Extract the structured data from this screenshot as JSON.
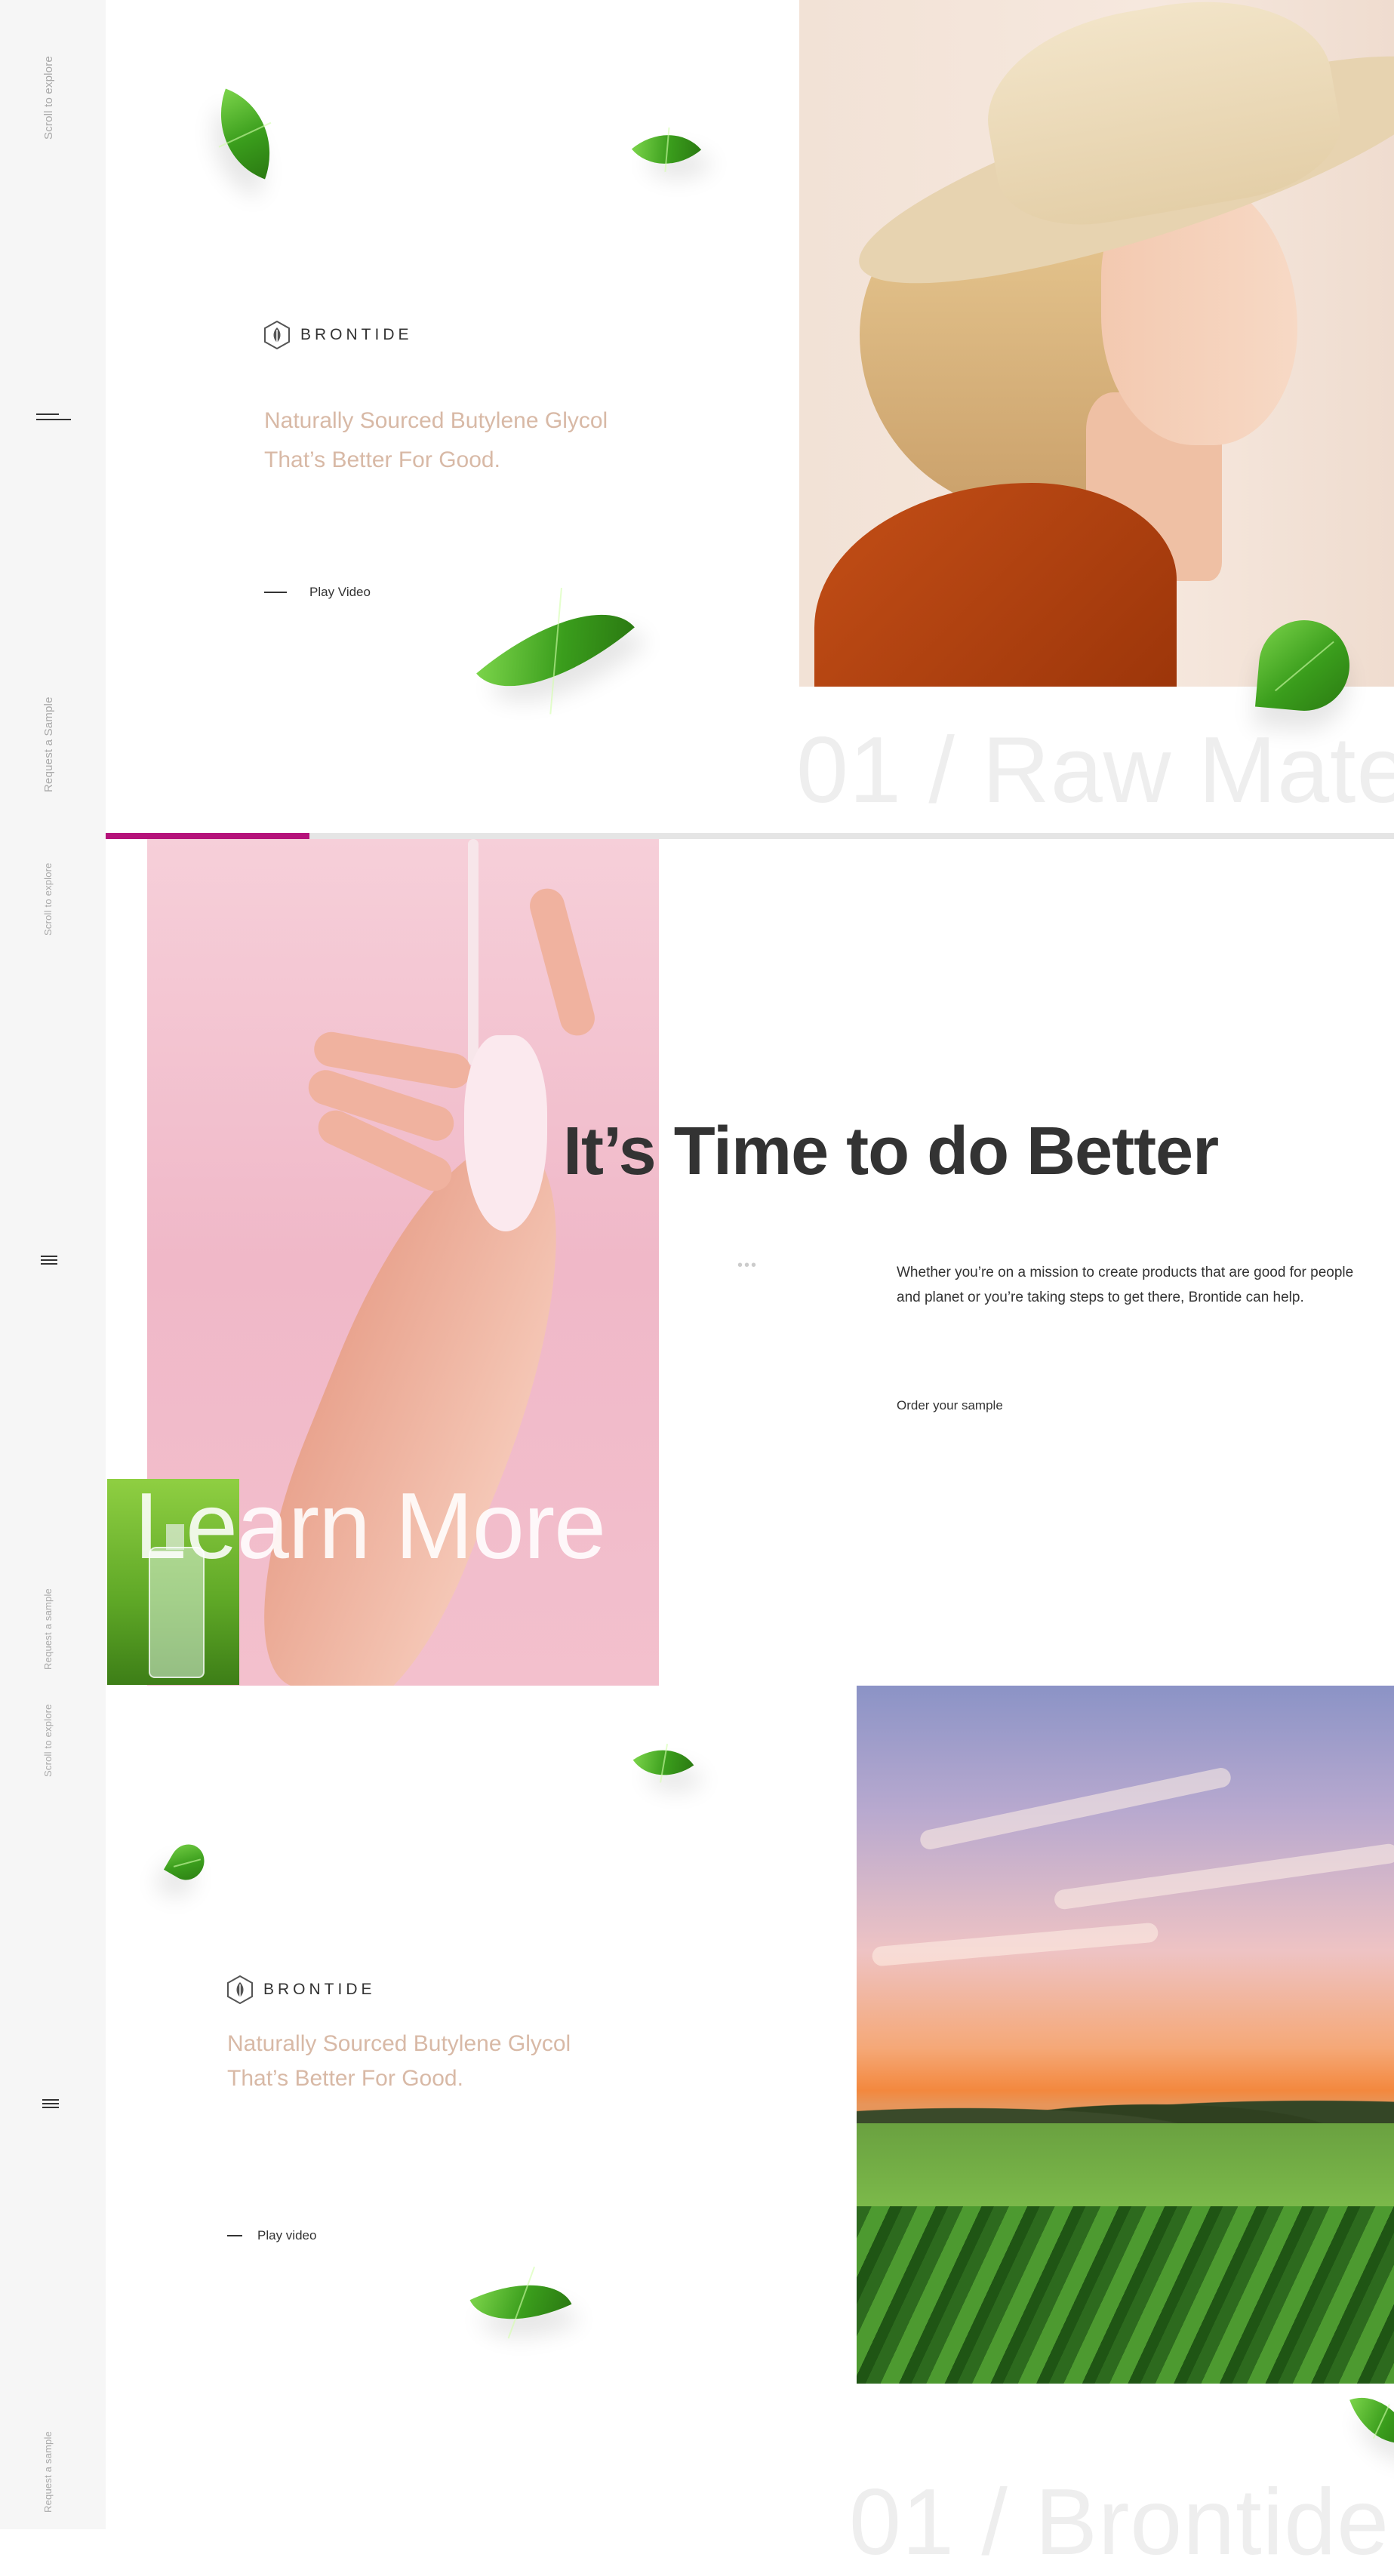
{
  "rail": {
    "scroll_top": "Scroll to explore",
    "request_top": "Request a Sample",
    "scroll_mid": "Scroll to explore",
    "request_mid": "Request a sample",
    "scroll_low": "Scroll to explore",
    "request_bottom": "Request a sample"
  },
  "hero1": {
    "brand": "BRONTIDE",
    "tagline_line1": "Naturally Sourced Butylene Glycol",
    "tagline_line2": "That’s Better For Good.",
    "play_label": "Play Video",
    "section_label": "01 / Raw Mate"
  },
  "progress": {
    "value": 0.158,
    "color": "#b5127a"
  },
  "section2": {
    "headline": "It’s Time to do Better",
    "dots": "•••",
    "paragraph": "Whether you’re on a mission to create products that are good for people and planet or you’re taking steps to get there, Brontide can help.",
    "order_link": "Order your sample",
    "learn_more": "Learn More"
  },
  "hero2": {
    "brand": "BRONTIDE",
    "tagline_line1": "Naturally Sourced Butylene Glycol",
    "tagline_line2": "That’s Better For Good.",
    "play_label": "Play video",
    "section_label": "01 / Brontide"
  },
  "icons": {
    "menu_top": "menu-icon",
    "menu_mid": "menu-icon",
    "menu_low": "menu-icon",
    "logo": "brontide-logo-icon",
    "leaf": "leaf-icon"
  },
  "colors": {
    "accent": "#b5127a",
    "tagline": "#d8b9a6",
    "rail": "#f6f6f6"
  }
}
